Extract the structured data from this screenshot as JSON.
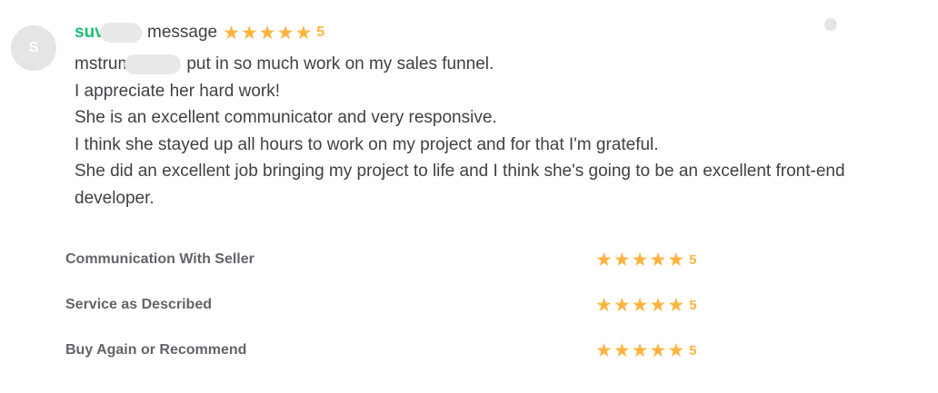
{
  "review": {
    "avatar_initial": "S",
    "username_visible": "suvi",
    "header_label": "message",
    "rating": "5",
    "star_icon": "star-icon",
    "star_color": "#ffb33e",
    "username_color": "#1dbf73",
    "body_first_line_prefix": "mstrum",
    "body_first_line_suffix": "put in so much work on my sales funnel.",
    "body_lines": [
      "I appreciate her hard work!",
      "She is an excellent communicator and very responsive.",
      "I think she stayed up all hours to work on my project and for that I'm grateful.",
      "She did an excellent job bringing my project to life and I think she's going to be an excellent front-end developer."
    ]
  },
  "sub_ratings": [
    {
      "label": "Communication With Seller",
      "value": "5"
    },
    {
      "label": "Service as Described",
      "value": "5"
    },
    {
      "label": "Buy Again or Recommend",
      "value": "5"
    }
  ]
}
